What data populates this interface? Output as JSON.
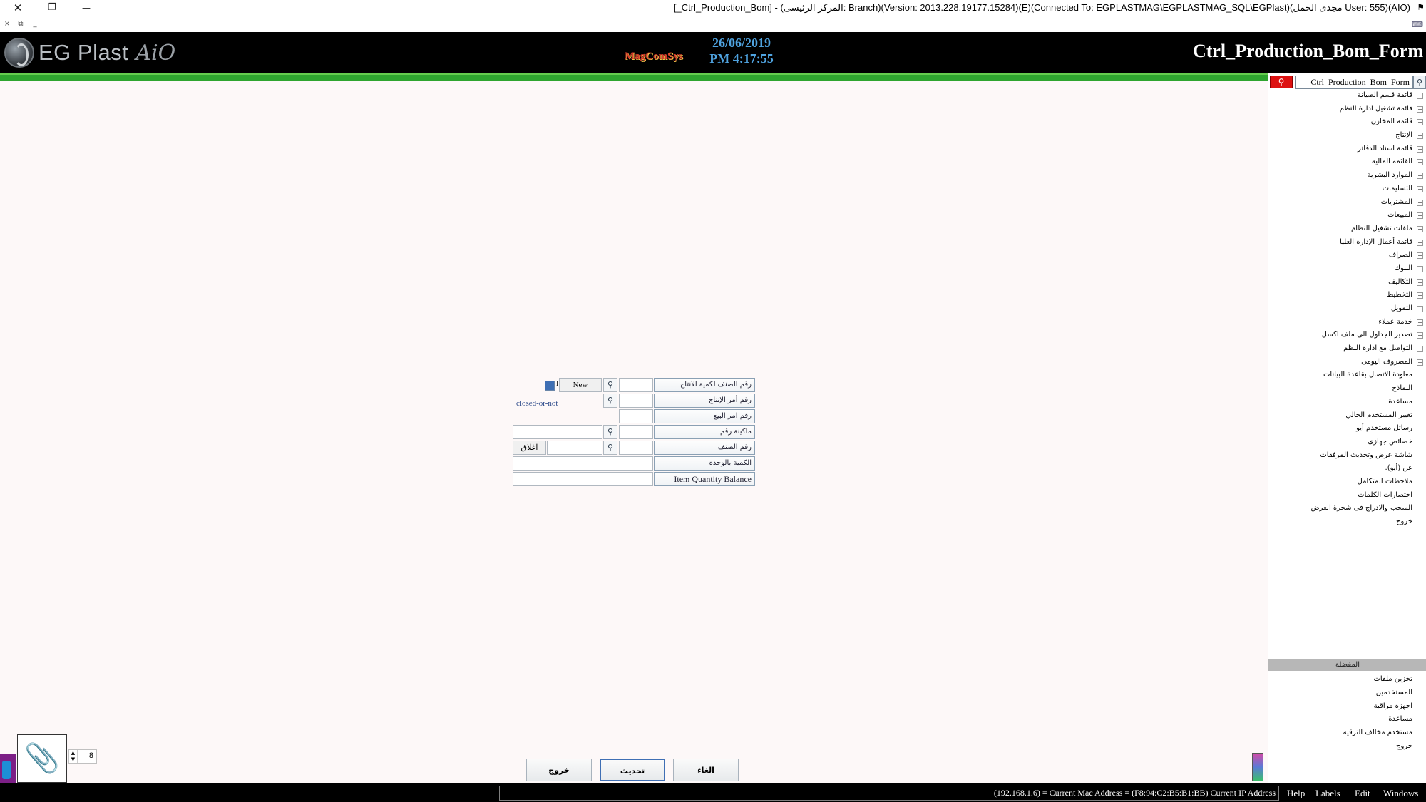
{
  "window": {
    "title": "[_Ctrl_Production_Bom] - (المركز الرئيسى: Branch)(Version: 2013.228.19177.15284)(E)(Connected To: EGPLASTMAG\\EGPLASTMAG_SQL\\EGPlast)(مجدى الجمل User: 555)(AIO)",
    "close_glyph": "✕",
    "restore_glyph": "❐",
    "minimize_glyph": "—",
    "mdi_close_glyph": "×",
    "mdi_restore_glyph": "⧉",
    "mdi_minimize_glyph": "_"
  },
  "header": {
    "logo_text": "EG Plast",
    "logo_signature": "AiO",
    "company_logo": "MagComSys",
    "date": "26/06/2019",
    "time": "PM 4:17:55",
    "form_name": "Ctrl_Production_Bom_Form"
  },
  "search": {
    "value": "Ctrl_Production_Bom_Form",
    "button_icon": "search-icon"
  },
  "tree": {
    "items": [
      {
        "label": "قائمة قسم الصيانة",
        "expandable": true
      },
      {
        "label": "قائمة تشغيل ادارة النظم",
        "expandable": true
      },
      {
        "label": "قائمة المخازن",
        "expandable": true
      },
      {
        "label": "الإنتاج",
        "expandable": true
      },
      {
        "label": "قائمة اسناد الدفاتر",
        "expandable": true
      },
      {
        "label": "القائمة المالية",
        "expandable": true
      },
      {
        "label": "الموارد البشرية",
        "expandable": true
      },
      {
        "label": "التسليمات",
        "expandable": true
      },
      {
        "label": "المشتريات",
        "expandable": true
      },
      {
        "label": "المبيعات",
        "expandable": true
      },
      {
        "label": "ملفات تشغيل النظام",
        "expandable": true
      },
      {
        "label": "قائمة أعمال الإدارة العليا",
        "expandable": true
      },
      {
        "label": "الصراف",
        "expandable": true
      },
      {
        "label": "البنوك",
        "expandable": true
      },
      {
        "label": "التكاليف",
        "expandable": true
      },
      {
        "label": "التخطيط",
        "expandable": true
      },
      {
        "label": "التمويل",
        "expandable": true
      },
      {
        "label": "خدمة عملاء",
        "expandable": true
      },
      {
        "label": "تصدير الجداول الى ملف اكسل",
        "expandable": true
      },
      {
        "label": "التواصل مع ادارة النظم",
        "expandable": true
      },
      {
        "label": "المصروف اليومى",
        "expandable": true
      },
      {
        "label": "معاودة الاتصال بقاعدة البيانات",
        "expandable": false
      },
      {
        "label": "النماذج",
        "expandable": false
      },
      {
        "label": "مساعدة",
        "expandable": false
      },
      {
        "label": "تغيير المستخدم الحالي",
        "expandable": false
      },
      {
        "label": "رسائل مستخدم أيو",
        "expandable": false
      },
      {
        "label": "خصائص جهازى",
        "expandable": false
      },
      {
        "label": "شاشة عرض وتحديث المرفقات",
        "expandable": false
      },
      {
        "label": "عن (أيو).",
        "expandable": false
      },
      {
        "label": "ملاحظات المتكامل",
        "expandable": false
      },
      {
        "label": "اختصارات الكلمات",
        "expandable": false
      },
      {
        "label": "السحب والادراج فى شجرة العرض",
        "expandable": false
      },
      {
        "label": "خروج",
        "expandable": false
      }
    ]
  },
  "favorites": {
    "title": "المفضلة",
    "items": [
      {
        "label": "تخزين ملفات"
      },
      {
        "label": "المستخدمين"
      },
      {
        "label": "اجهزة مراقبة"
      },
      {
        "label": "مساعدة"
      },
      {
        "label": "مستخدم مخالف الترقية"
      },
      {
        "label": "خروج"
      }
    ]
  },
  "form": {
    "labels": {
      "item_no_for_production_qty": "رقم الصنف لكمية الانتاج",
      "production_order_no": "رقم أمر الإنتاج",
      "sales_order_no": "رقم امر البيع",
      "machine_no": "ماكينة رقم",
      "item_no": "رقم الصنف",
      "qty_per_unit": "الكمية بالوحدة",
      "item_quantity_balance": "Item Quantity Balance"
    },
    "new_button": "New",
    "checkbox_mark": "I",
    "closed_or_not": "closed-or-not",
    "close_button": "اغلاق"
  },
  "bottom_buttons": {
    "exit": "خروج",
    "update": "تحديث",
    "cancel": "الغاء"
  },
  "attachments": {
    "count": "8",
    "icon": "paperclip-icon"
  },
  "statusbar": {
    "info": "(192.168.1.6) = Current Mac Address = (F8:94:C2:B5:B1:BB) Current IP Address",
    "menu": [
      "Help",
      "Labels",
      "Edit",
      "Windows"
    ]
  },
  "colors": {
    "header_bg": "#000000",
    "green_bar": "#2fa52f",
    "date_time": "#4fa3e0",
    "search_button": "#d11111",
    "body_bg": "#fdf8f8"
  }
}
